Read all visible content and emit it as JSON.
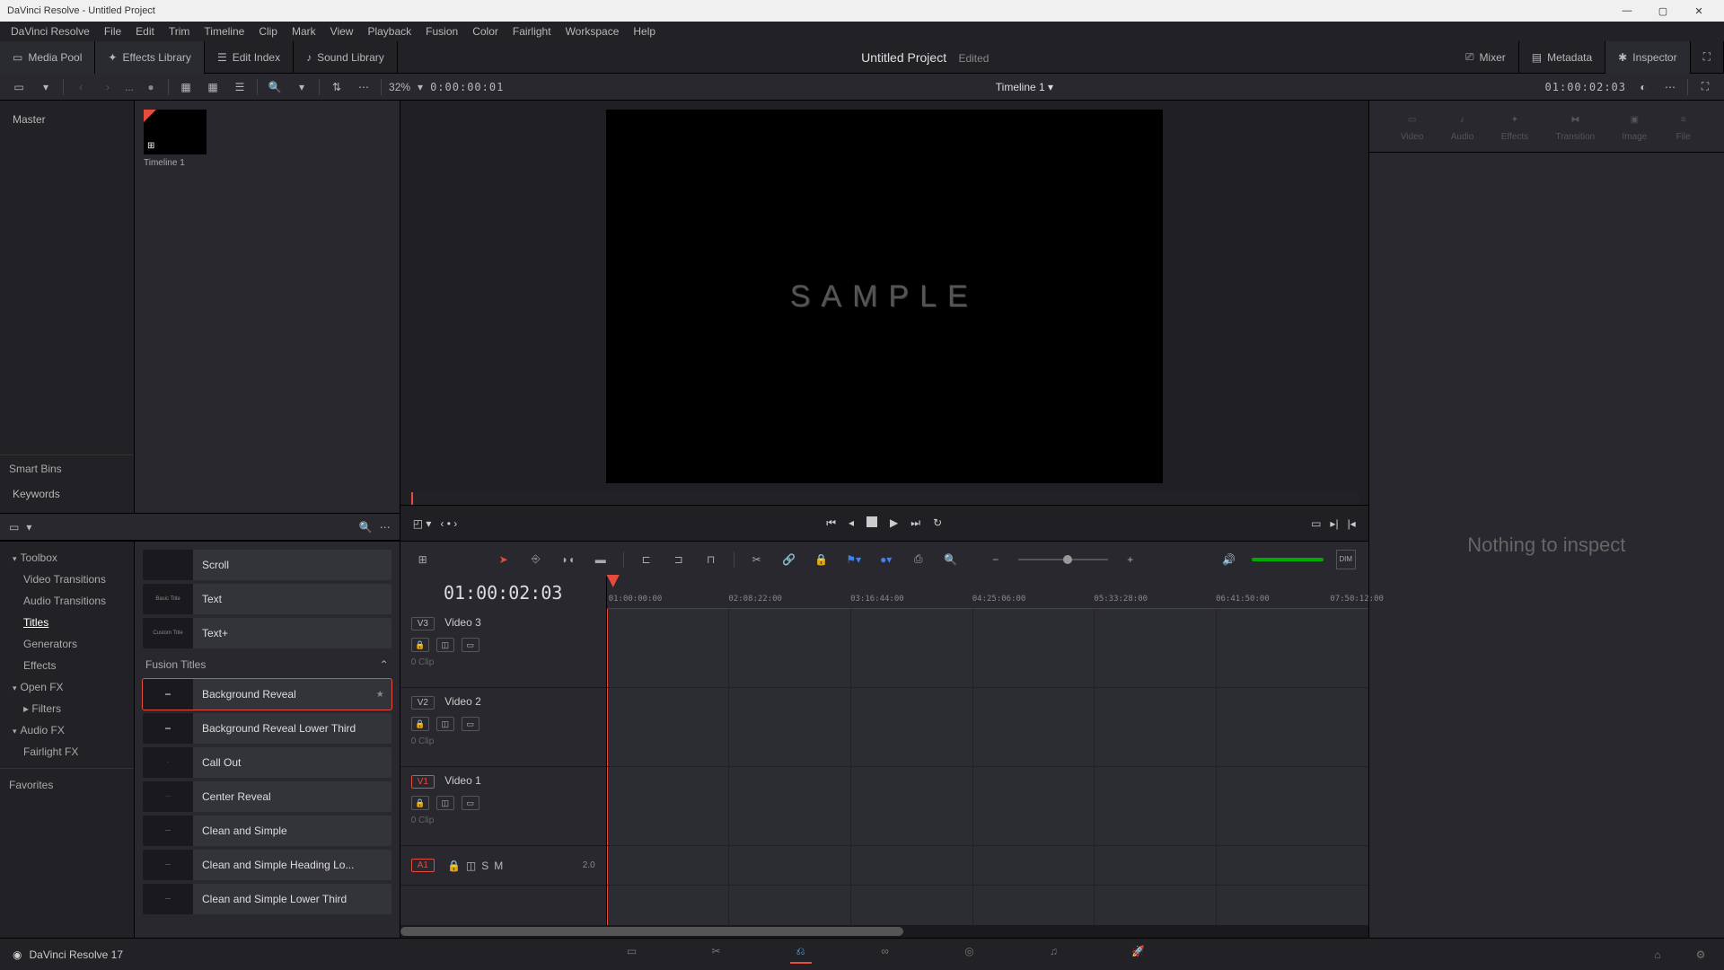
{
  "titlebar": {
    "text": "DaVinci Resolve - Untitled Project"
  },
  "menubar": [
    "DaVinci Resolve",
    "File",
    "Edit",
    "Trim",
    "Timeline",
    "Clip",
    "Mark",
    "View",
    "Playback",
    "Fusion",
    "Color",
    "Fairlight",
    "Workspace",
    "Help"
  ],
  "toolbar": {
    "media_pool": "Media Pool",
    "effects_library": "Effects Library",
    "edit_index": "Edit Index",
    "sound_library": "Sound Library",
    "project": "Untitled Project",
    "edited": "Edited",
    "mixer": "Mixer",
    "metadata": "Metadata",
    "inspector": "Inspector"
  },
  "sub": {
    "zoom": "32%",
    "src_tc": "0:00:00:01",
    "timeline_name": "Timeline 1",
    "prog_tc": "01:00:02:03"
  },
  "bins": {
    "master": "Master",
    "smart_bins": "Smart Bins",
    "keywords": "Keywords"
  },
  "clip": {
    "name": "Timeline 1"
  },
  "fx_tree": {
    "toolbox": "Toolbox",
    "video_transitions": "Video Transitions",
    "audio_transitions": "Audio Transitions",
    "titles": "Titles",
    "generators": "Generators",
    "effects": "Effects",
    "open_fx": "Open FX",
    "filters": "Filters",
    "audio_fx": "Audio FX",
    "fairlight_fx": "Fairlight FX",
    "favorites": "Favorites"
  },
  "title_items": {
    "scroll": "Scroll",
    "text": "Text",
    "text_plus": "Text+",
    "basic": "Basic Title",
    "custom": "Custom Title"
  },
  "fusion_titles_hdr": "Fusion Titles",
  "fusion_titles": {
    "bg_reveal": "Background Reveal",
    "bg_reveal_lt": "Background Reveal Lower Third",
    "call_out": "Call Out",
    "center_reveal": "Center Reveal",
    "clean_simple": "Clean and Simple",
    "clean_simple_hdg": "Clean and Simple Heading Lo...",
    "clean_simple_lt": "Clean and Simple Lower Third"
  },
  "viewer": {
    "sample": "SAMPLE"
  },
  "timeline": {
    "tc": "01:00:02:03",
    "ticks": [
      "01:00:00:00",
      "02:08:22:00",
      "03:16:44:00",
      "04:25:06:00",
      "05:33:28:00",
      "06:41:50:00",
      "07:50:12:00"
    ],
    "tracks": {
      "v3": {
        "badge": "V3",
        "name": "Video 3",
        "clips": "0 Clip"
      },
      "v2": {
        "badge": "V2",
        "name": "Video 2",
        "clips": "0 Clip"
      },
      "v1": {
        "badge": "V1",
        "name": "Video 1",
        "clips": "0 Clip"
      },
      "a1": {
        "badge": "A1",
        "meter": "2.0"
      }
    }
  },
  "inspector": {
    "empty": "Nothing to inspect",
    "tabs": {
      "video": "Video",
      "audio": "Audio",
      "effects": "Effects",
      "transition": "Transition",
      "image": "Image",
      "file": "File"
    }
  },
  "bottombar": {
    "app": "DaVinci Resolve 17"
  }
}
